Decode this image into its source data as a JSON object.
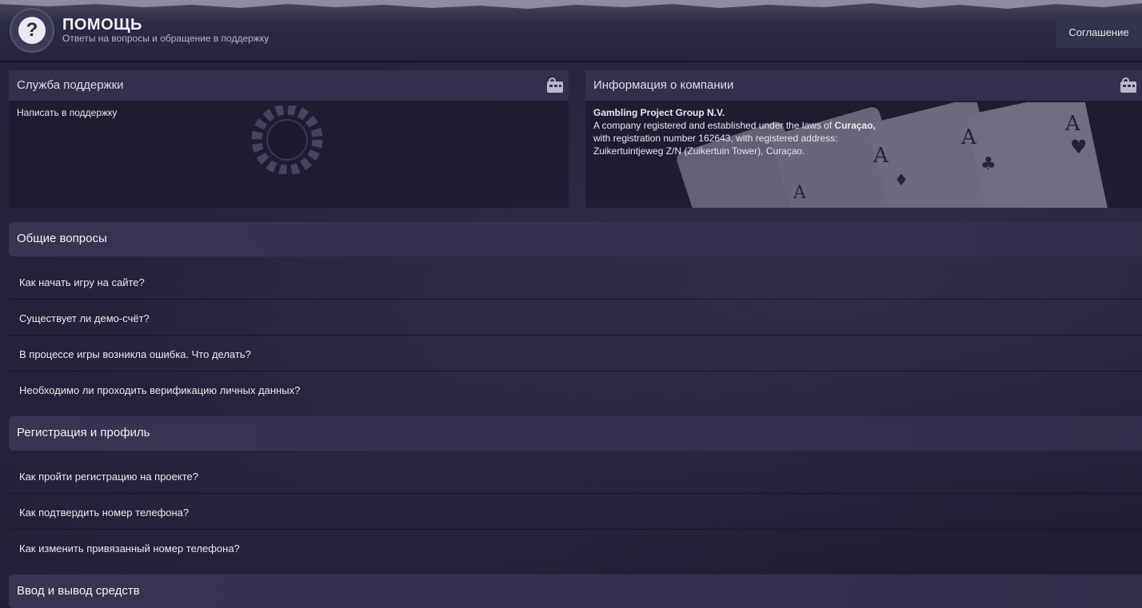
{
  "header": {
    "title": "ПОМОЩЬ",
    "subtitle": "Ответы на вопросы и обращение в поддержку",
    "agreement_label": "Соглашение",
    "help_icon_glyph": "?"
  },
  "support_panel": {
    "title": "Служба поддержки",
    "link_label": "Написать в поддержку"
  },
  "company_panel": {
    "title": "Информация о компании",
    "company_name": "Gambling Project Group N.V.",
    "line1_pre": "A company registered and established under the laws of ",
    "line1_bold": "Curaçao,",
    "line2": "with registration number 162643, with registered address:",
    "line3": "Zuikertuintjeweg Z/N (Zuikertuin Tower), Curaçao."
  },
  "sections": [
    {
      "title": "Общие вопросы",
      "items": [
        "Как начать игру на сайте?",
        "Существует ли демо-счёт?",
        "В процессе игры возникла ошибка. Что делать?",
        "Необходимо ли проходить верификацию личных данных?"
      ]
    },
    {
      "title": "Регистрация и профиль",
      "items": [
        "Как пройти регистрацию на проекте?",
        "Как подтвердить номер телефона?",
        "Как изменить привязанный номер телефона?"
      ]
    },
    {
      "title": "Ввод и вывод средств",
      "items": []
    }
  ],
  "colors": {
    "background": "#23213a",
    "section_header": "#38364f",
    "accent_text": "#f0f0f5"
  }
}
